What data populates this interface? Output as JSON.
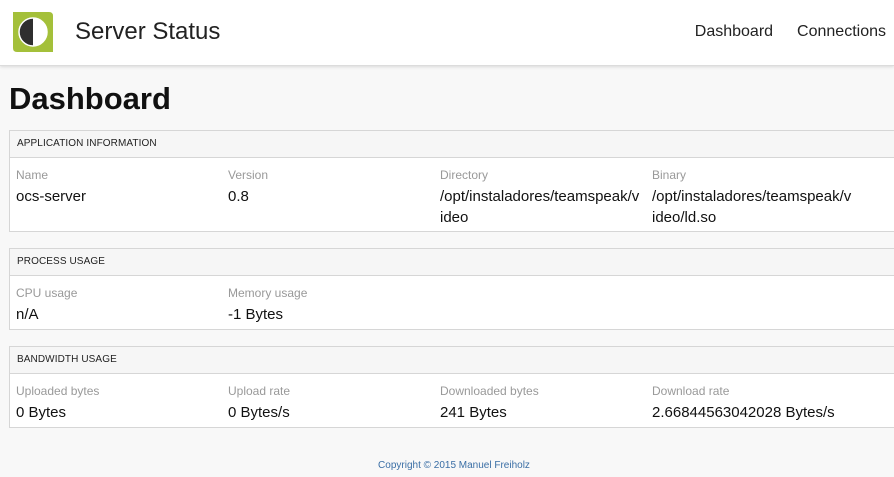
{
  "header": {
    "title": "Server Status",
    "nav": [
      "Dashboard",
      "Connections"
    ]
  },
  "colors": {
    "logo_green": "#a4c03a",
    "logo_dark": "#2f2f2f",
    "footer_link": "#3a6ea5"
  },
  "page": {
    "title": "Dashboard"
  },
  "panels": {
    "application": {
      "title": "APPLICATION INFORMATION",
      "fields": [
        {
          "label": "Name",
          "value": "ocs-server"
        },
        {
          "label": "Version",
          "value": "0.8"
        },
        {
          "label": "Directory",
          "value": "/opt/instaladores/teamspeak/video"
        },
        {
          "label": "Binary",
          "value": "/opt/instaladores/teamspeak/video/ld.so"
        }
      ]
    },
    "process": {
      "title": "PROCESS USAGE",
      "fields": [
        {
          "label": "CPU usage",
          "value": "n/A"
        },
        {
          "label": "Memory usage",
          "value": "-1 Bytes"
        }
      ]
    },
    "bandwidth": {
      "title": "BANDWIDTH USAGE",
      "fields": [
        {
          "label": "Uploaded bytes",
          "value": "0 Bytes"
        },
        {
          "label": "Upload rate",
          "value": "0 Bytes/s"
        },
        {
          "label": "Downloaded bytes",
          "value": "241 Bytes"
        },
        {
          "label": "Download rate",
          "value": "2.66844563042028 Bytes/s"
        }
      ]
    }
  },
  "footer": {
    "copyright": "Copyright © 2015 Manuel Freiholz"
  }
}
